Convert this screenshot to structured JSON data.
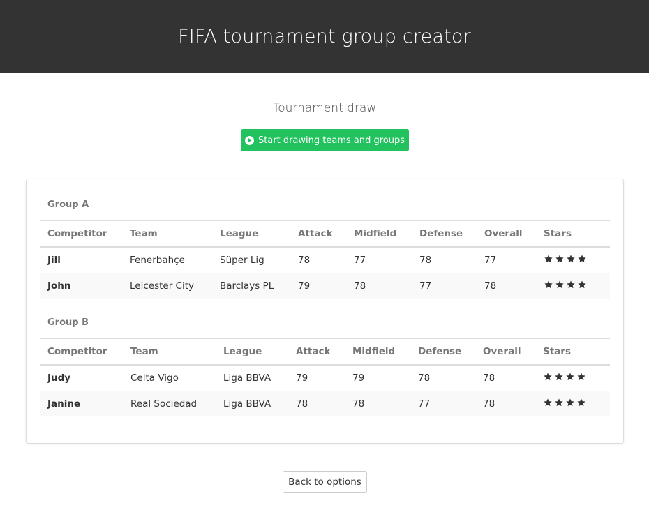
{
  "header": {
    "title": "FIFA tournament group creator"
  },
  "draw": {
    "title": "Tournament draw",
    "start_button_label": "Start drawing teams and groups",
    "start_button_icon": "play-circle-icon"
  },
  "colors": {
    "header_bg": "#333333",
    "accent_green": "#22c35e"
  },
  "columns": [
    "Competitor",
    "Team",
    "League",
    "Attack",
    "Midfield",
    "Defense",
    "Overall",
    "Stars"
  ],
  "groups": [
    {
      "name": "Group A",
      "rows": [
        {
          "competitor": "Jill",
          "team": "Fenerbahçe",
          "league": "Süper Lig",
          "attack": "78",
          "midfield": "77",
          "defense": "78",
          "overall": "77",
          "stars": 4
        },
        {
          "competitor": "John",
          "team": "Leicester City",
          "league": "Barclays PL",
          "attack": "79",
          "midfield": "78",
          "defense": "77",
          "overall": "78",
          "stars": 4
        }
      ]
    },
    {
      "name": "Group B",
      "rows": [
        {
          "competitor": "Judy",
          "team": "Celta Vigo",
          "league": "Liga BBVA",
          "attack": "79",
          "midfield": "79",
          "defense": "78",
          "overall": "78",
          "stars": 4
        },
        {
          "competitor": "Janine",
          "team": "Real Sociedad",
          "league": "Liga BBVA",
          "attack": "78",
          "midfield": "78",
          "defense": "77",
          "overall": "78",
          "stars": 4
        }
      ]
    }
  ],
  "footer": {
    "back_button_label": "Back to options"
  }
}
